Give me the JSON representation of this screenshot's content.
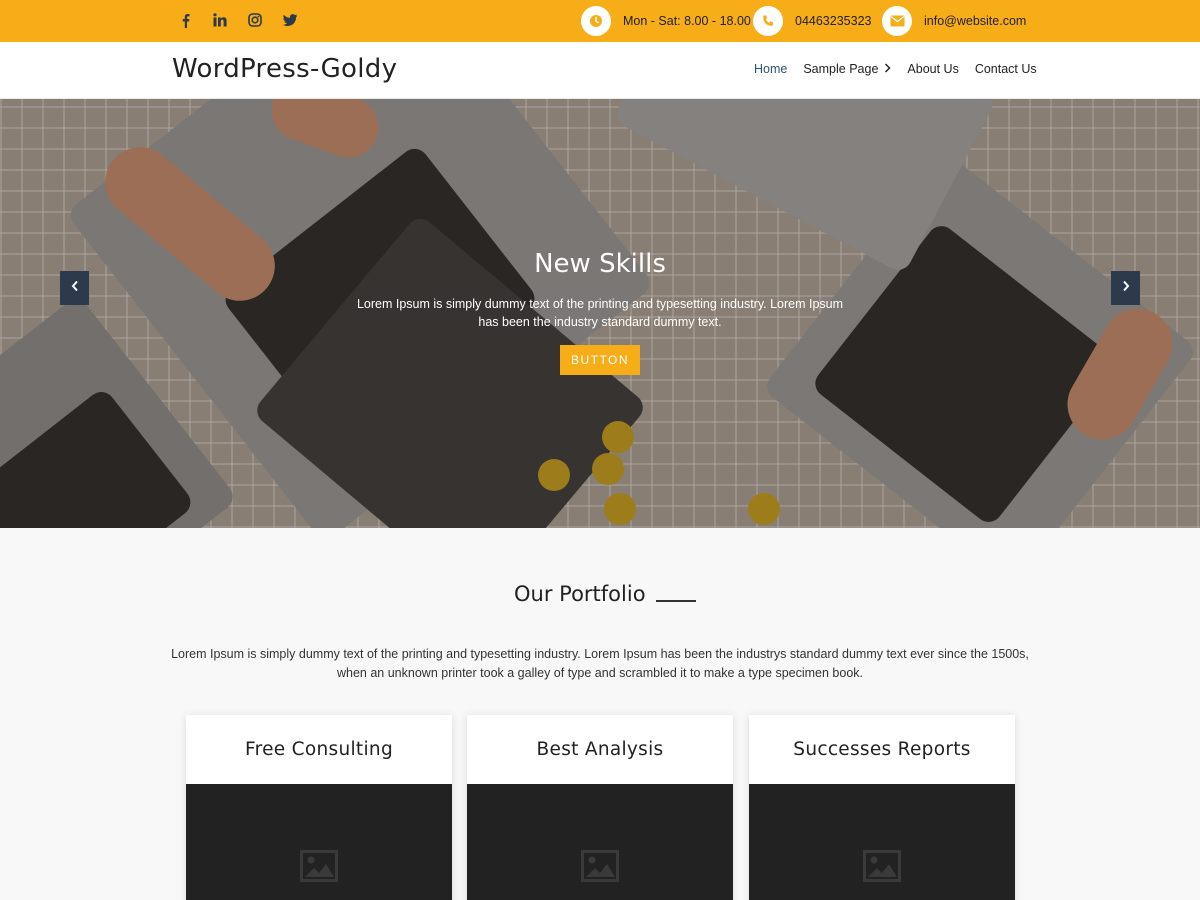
{
  "topbar": {
    "social": [
      {
        "icon": "facebook-icon"
      },
      {
        "icon": "linkedin-icon"
      },
      {
        "icon": "instagram-icon"
      },
      {
        "icon": "twitter-icon"
      }
    ],
    "hours": "Mon - Sat: 8.00 - 18.00",
    "phone": "04463235323",
    "email": "info@website.com",
    "accent_color": "#f7ad18"
  },
  "header": {
    "site_title": "WordPress-Goldy",
    "nav": [
      {
        "label": "Home",
        "active": true
      },
      {
        "label": "Sample Page",
        "has_submenu": true
      },
      {
        "label": "About Us"
      },
      {
        "label": "Contact Us"
      }
    ]
  },
  "hero": {
    "title": "New Skills",
    "text": "Lorem Ipsum is simply dummy text of the printing and typesetting industry. Lorem Ipsum has been the industry standard dummy text.",
    "button_label": "BUTTON",
    "prev_icon": "chevron-left-icon",
    "next_icon": "chevron-right-icon"
  },
  "portfolio": {
    "title": "Our Portfolio",
    "description": "Lorem Ipsum is simply dummy text of the printing and typesetting industry. Lorem Ipsum has been the industrys standard dummy text ever since the 1500s, when an unknown printer took a galley of type and scrambled it to make a type specimen book.",
    "cards": [
      {
        "title": "Free Consulting",
        "image_icon": "image-placeholder-icon"
      },
      {
        "title": "Best Analysis",
        "image_icon": "image-placeholder-icon"
      },
      {
        "title": "Successes Reports",
        "image_icon": "image-placeholder-icon"
      }
    ]
  }
}
